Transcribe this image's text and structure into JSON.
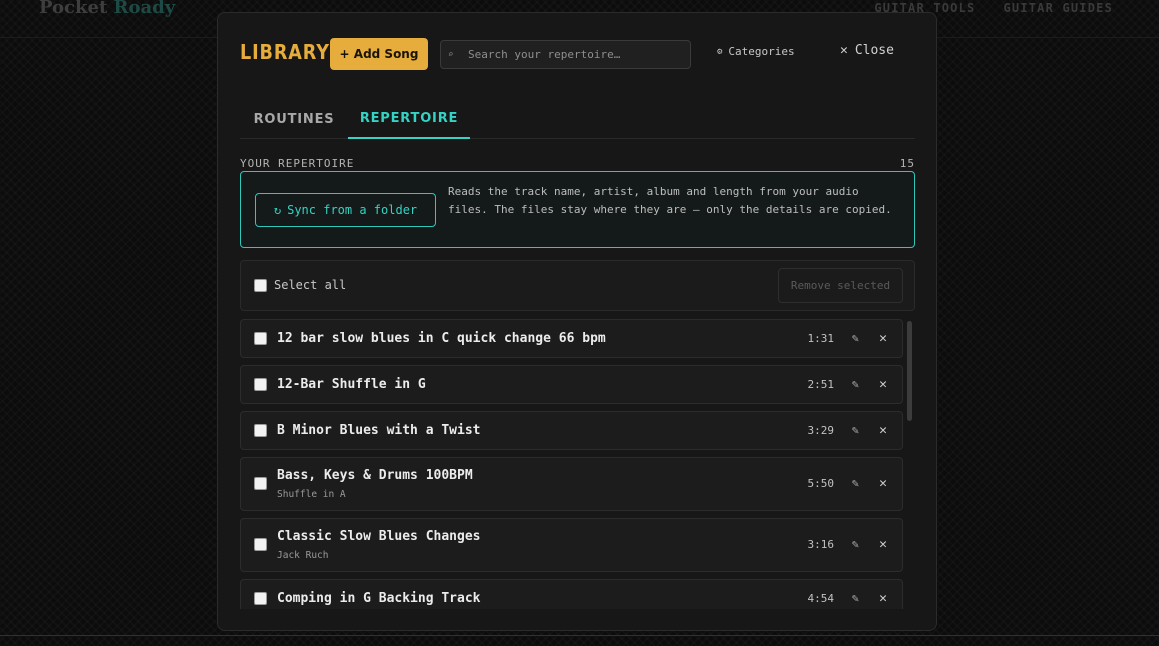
{
  "site": {
    "brand_part1": "Pocket",
    "brand_part2": "Roady",
    "nav": [
      "GUITAR TOOLS",
      "GUITAR GUIDES"
    ]
  },
  "modal": {
    "title": "LIBRARY",
    "add_song_label": "+ Add Song",
    "search_placeholder": "Search your repertoire…",
    "categories_label": "Categories",
    "close_label": "Close",
    "tabs": {
      "routines": "ROUTINES",
      "repertoire": "REPERTOIRE"
    },
    "active_tab": "REPERTOIRE",
    "section_label": "YOUR REPERTOIRE",
    "song_count": "15",
    "sync": {
      "button_label": "Sync from a folder",
      "description": "Reads the track name, artist, album and length from your audio files. The files stay where they are — only the details are copied."
    },
    "select_all_label": "Select all",
    "remove_selected_label": "Remove selected",
    "songs": [
      {
        "title": "12 bar slow blues in C quick change 66 bpm",
        "artist": "",
        "duration": "1:31"
      },
      {
        "title": "12-Bar Shuffle in G",
        "artist": "",
        "duration": "2:51"
      },
      {
        "title": "B Minor Blues with a Twist",
        "artist": "",
        "duration": "3:29"
      },
      {
        "title": "Bass, Keys & Drums 100BPM",
        "artist": "Shuffle in A",
        "duration": "5:50"
      },
      {
        "title": "Classic Slow Blues Changes",
        "artist": "Jack Ruch",
        "duration": "3:16"
      },
      {
        "title": "Comping in G Backing Track",
        "artist": "",
        "duration": "4:54"
      }
    ]
  },
  "icons": {
    "search": "search-icon",
    "categories": "gear-icon",
    "close": "close-icon",
    "sync": "refresh-icon",
    "edit": "pencil-icon",
    "remove": "close-icon"
  },
  "colors": {
    "accent_gold": "#e6ac3c",
    "accent_teal": "#34d3c3",
    "panel_bg": "#171717"
  }
}
